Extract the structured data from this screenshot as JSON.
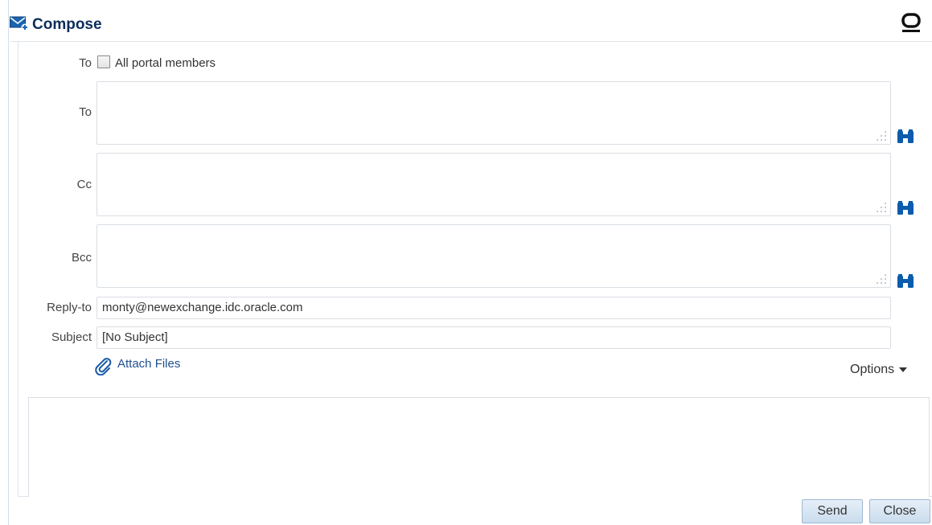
{
  "header": {
    "title": "Compose",
    "compose_icon": "compose-mail-icon",
    "brand_icon": "oracle-o-icon",
    "title_color": "#0d2d5a"
  },
  "form": {
    "to_checkbox_label": "To",
    "all_members_label": "All portal members",
    "all_members_checked": false,
    "to_label": "To",
    "to_value": "",
    "cc_label": "Cc",
    "cc_value": "",
    "bcc_label": "Bcc",
    "bcc_value": "",
    "reply_to_label": "Reply-to",
    "reply_to_value": "monty@newexchange.idc.oracle.com",
    "subject_label": "Subject",
    "subject_value": "[No Subject]",
    "attach_label": "Attach Files",
    "options_label": "Options",
    "search_icon": "binoculars-icon",
    "link_color": "#1f4f8f",
    "icon_color": "#0b5cad"
  },
  "body": {
    "value": ""
  },
  "footer": {
    "send_label": "Send",
    "close_label": "Close"
  }
}
